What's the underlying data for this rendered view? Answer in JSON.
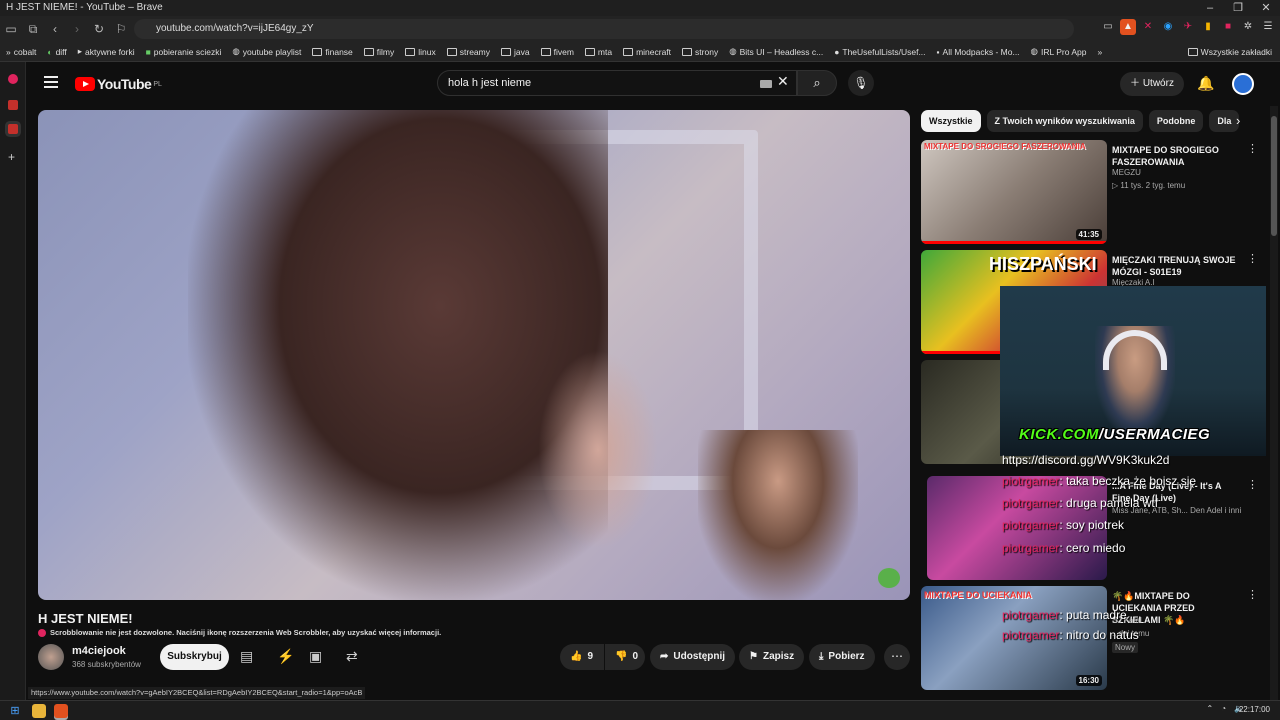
{
  "window": {
    "title": "H JEST NIEME! - YouTube – Brave"
  },
  "browser": {
    "url": "youtube.com/watch?v=ijJE64gy_zY"
  },
  "bookmarks": [
    {
      "label": "cobalt"
    },
    {
      "label": "diff"
    },
    {
      "label": "aktywne forki"
    },
    {
      "label": "pobieranie sciezki"
    },
    {
      "label": "youtube playlist"
    },
    {
      "label": "finanse"
    },
    {
      "label": "filmy"
    },
    {
      "label": "linux"
    },
    {
      "label": "streamy"
    },
    {
      "label": "java"
    },
    {
      "label": "fivem"
    },
    {
      "label": "mta"
    },
    {
      "label": "minecraft"
    },
    {
      "label": "strony"
    },
    {
      "label": "Bits UI – Headless c..."
    },
    {
      "label": "TheUsefulLists/Usef..."
    },
    {
      "label": "All Modpacks - Mo..."
    },
    {
      "label": "IRL Pro App"
    }
  ],
  "bookmarks_more": "»",
  "bookmarks_all": "Wszystkie zakładki",
  "youtube": {
    "logo_text": "YouTube",
    "logo_region": "PL",
    "search_value": "hola h jest nieme",
    "create_label": "Utwórz"
  },
  "video": {
    "title": "H JEST NIEME!",
    "scrobbler_notice": "Scrobblowanie nie jest dozwolone. Naciśnij ikonę rozszerzenia Web Scrobbler, aby uzyskać więcej informacji.",
    "channel_name": "m4ciejook",
    "channel_subs": "368 subskrybentów",
    "subscribe_label": "Subskrybuj",
    "likes": "9",
    "dislikes": "0",
    "share_label": "Udostępnij",
    "save_label": "Zapisz",
    "download_label": "Pobierz"
  },
  "status_url": "https://www.youtube.com/watch?v=gAebIY2BCEQ&list=RDgAebIY2BCEQ&start_radio=1&pp=oAcB",
  "chips": [
    "Wszystkie",
    "Z Twoich wyników wyszukiwania",
    "Podobne",
    "Dla"
  ],
  "recommendations": [
    {
      "title": "MIXTAPE DO SROGIEGO FASZEROWANIA",
      "channel": "MEGZU",
      "meta": "▷ 11 tys.   2 tyg. temu",
      "duration": "41:35",
      "thumb_text": "MIXTAPE DO SROGIEGO FASZEROWANIA"
    },
    {
      "title": "MIĘCZAKI TRENUJĄ SWOJE MÓZGI - S01E19",
      "channel": "Mięczaki A.I",
      "thumb_text": "HISZPAŃSKI"
    },
    {
      "title": "",
      "channel": "",
      "thumb_text": ""
    },
    {
      "title": "...A Fine Day (Live) - It's A Fine Day (Live)",
      "channel": "Miss Jane, ATB, Sh... Den Adel i inni",
      "thumb_text": ""
    },
    {
      "title": "🌴🔥MIXTAPE DO UCIEKANIA PRZED SZKIELAMI 🌴🔥",
      "channel": "DJ Fatal",
      "meta": "...dni temu",
      "badge": "Nowy",
      "duration": "16:30",
      "thumb_text": "MIXTAPE DO UCIEKANIA"
    }
  ],
  "stream_overlay": {
    "kick_prefix": "KICK.COM",
    "kick_user": "/USERMACIEG",
    "discord": "https://discord.gg/WV9K3kuk2d",
    "chat": [
      {
        "user": "piotrgamer",
        "msg": "taka beczka że boisz się"
      },
      {
        "user": "piotrgamer",
        "msg": "druga pamela wtf"
      },
      {
        "user": "piotrgamer",
        "msg": "soy piotrek"
      },
      {
        "user": "piotrgamer",
        "msg": "cero miedo"
      },
      {
        "user": "piotrgamer",
        "msg": "puta madre"
      },
      {
        "user": "piotrgamer",
        "msg": "nitro do natus"
      }
    ]
  },
  "taskbar": {
    "time": "22:17:00"
  }
}
